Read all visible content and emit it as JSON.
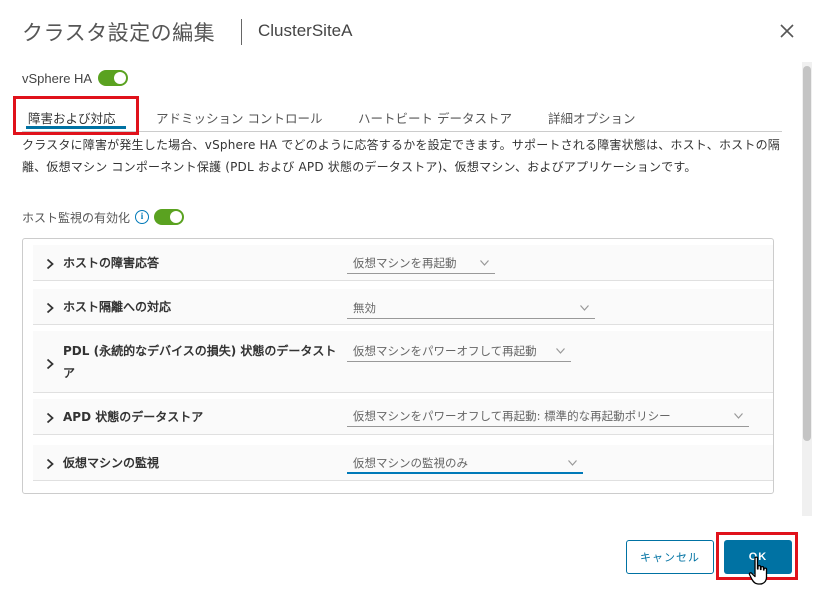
{
  "dialog": {
    "title": "クラスタ設定の編集",
    "subtitle": "ClusterSiteA"
  },
  "ha": {
    "label": "vSphere HA",
    "enabled": true
  },
  "tabs": [
    {
      "label": "障害および対応",
      "active": true
    },
    {
      "label": "アドミッション コントロール",
      "active": false
    },
    {
      "label": "ハートビート データストア",
      "active": false
    },
    {
      "label": "詳細オプション",
      "active": false
    }
  ],
  "description": "クラスタに障害が発生した場合、vSphere HA でどのように応答するかを設定できます。サポートされる障害状態は、ホスト、ホストの隔離、仮想マシン コンポーネント保護 (PDL および APD 状態のデータストア)、仮想マシン、およびアプリケーションです。",
  "host_monitoring": {
    "label": "ホスト監視の有効化",
    "enabled": true
  },
  "rows": [
    {
      "label": "ホストの障害応答",
      "value": "仮想マシンを再起動"
    },
    {
      "label": "ホスト隔離への対応",
      "value": "無効"
    },
    {
      "label": "PDL (永続的なデバイスの損失) 状態のデータストア",
      "value": "仮想マシンをパワーオフして再起動"
    },
    {
      "label": "APD 状態のデータストア",
      "value": "仮想マシンをパワーオフして再起動: 標準的な再起動ポリシー"
    },
    {
      "label": "仮想マシンの監視",
      "value": "仮想マシンの監視のみ"
    }
  ],
  "footer": {
    "cancel_label": "キャンセル",
    "ok_label": "OK"
  },
  "colors": {
    "accent": "#0072a3",
    "toggle_on": "#5aa220",
    "highlight": "#e0121b"
  }
}
